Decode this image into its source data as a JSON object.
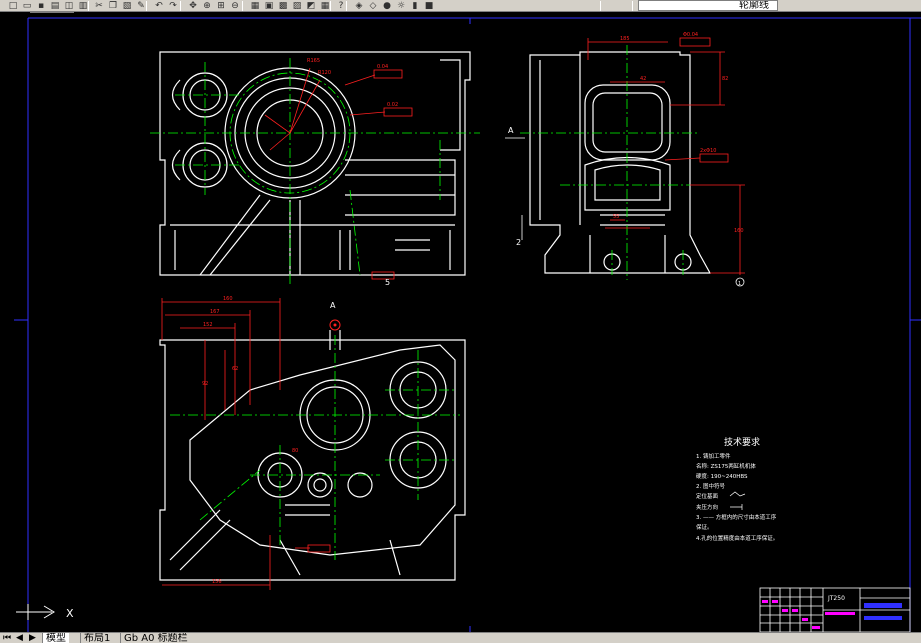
{
  "toolbar": {
    "layer_name": "轮廓线",
    "icons": [
      "new-icon",
      "open-icon",
      "save-icon",
      "print-icon",
      "preview-icon",
      "plot-icon",
      "cut-icon",
      "copy-icon",
      "paste-icon",
      "matchprop-icon",
      "undo-icon",
      "redo-icon",
      "pan-icon",
      "zoom-realtime-icon",
      "zoom-window-icon",
      "zoom-previous-icon",
      "properties-icon",
      "design-center-icon",
      "tool-palette-icon",
      "sheet-set-icon",
      "markup-icon",
      "calc-icon",
      "help-icon",
      "layer-manager-icon",
      "layer-state-icon",
      "layer-on-icon",
      "layer-freeze-icon",
      "layer-lock-icon",
      "layer-color-icon"
    ]
  },
  "colors": {
    "background": "#000000",
    "outline": "#ffffff",
    "centerline": "#00ff00",
    "dimension": "#ff2020",
    "hatch": "#ffffff",
    "frame": "#3030ff",
    "titleblock_accent": "#ff00ff"
  },
  "drawing": {
    "view_label_a_top": "A",
    "view_label_a_side": "A",
    "section_label": "2",
    "tech_title": "技术要求",
    "tech_lines": [
      "1. 铸加工零件",
      "名称: ZS175两缸机机体",
      "硬度: 190~240HBS",
      "2. 图中符号",
      "定位基面 ",
      "夹压方向 ",
      "3. —— 方框内的尺寸由本道工序",
      "保证。",
      "4.孔的位置精度由本道工序保证。"
    ],
    "dims_top": [
      "R165",
      "R120",
      "0.04",
      "0.02",
      "Φ0.04",
      "0.02",
      "#",
      "0.04"
    ],
    "dims_side": [
      "185",
      "Φ0.04",
      "82",
      "42",
      "2xΦ10",
      "55",
      "160"
    ],
    "dims_plan": [
      "160",
      "167",
      "152",
      "92",
      "62",
      "80",
      "156"
    ],
    "circle_marker": "1",
    "titleblock_code": "JT250"
  },
  "statusbar": {
    "tabs": [
      "模型",
      "布局1",
      "Gb A0 标题栏"
    ],
    "ucs_x": "X"
  }
}
